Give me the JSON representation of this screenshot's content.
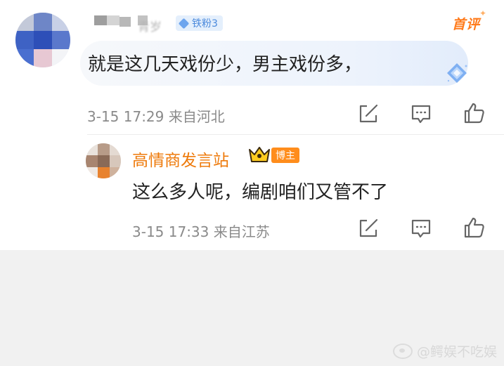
{
  "main_comment": {
    "username": "青岁",
    "fan_badge": "铁粉3",
    "top_label": "首评",
    "text": "就是这几天戏份少，男主戏份多，",
    "time": "3-15 17:29",
    "location": "来自河北"
  },
  "reply": {
    "username": "高情商发言站",
    "role_badge": "博主",
    "text": "这么多人呢，编剧咱们又管不了",
    "time": "3-15 17:33",
    "location": "来自江苏"
  },
  "watermark": "@鳄娱不吃娱",
  "icons": {
    "share": "share-icon",
    "comment": "comment-icon",
    "like": "like-icon",
    "crown": "crown-icon",
    "gem": "gem-icon"
  },
  "colors": {
    "accent_orange": "#ee7a0b",
    "badge_blue": "#4a89dc",
    "meta_gray": "#8a8a8a",
    "text_dark": "#222222",
    "page_bg": "#f1f1f1"
  }
}
